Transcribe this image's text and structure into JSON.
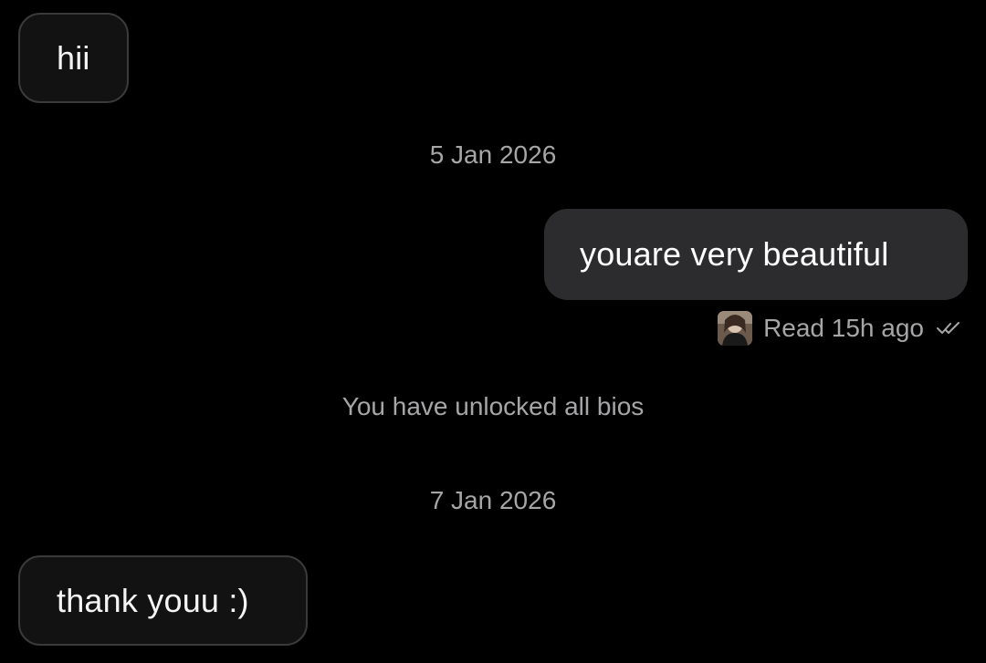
{
  "conversation": {
    "messages": [
      {
        "direction": "incoming",
        "text": "hii"
      },
      {
        "direction": "outgoing",
        "text": "youare very beautiful"
      },
      {
        "direction": "incoming",
        "text": "thank youu :)"
      }
    ],
    "date_separators": [
      "5 Jan 2026",
      "7 Jan 2026"
    ],
    "system_note": "You have unlocked all bios",
    "read_receipt": {
      "text": "Read 15h ago",
      "avatar_icon": "profile-avatar",
      "status_icon": "double-check-icon"
    }
  },
  "colors": {
    "background": "#000000",
    "incoming_bubble": "#121212",
    "incoming_border": "#3a3a3a",
    "outgoing_bubble": "#2c2c2e",
    "muted_text": "#a6a6a8"
  }
}
